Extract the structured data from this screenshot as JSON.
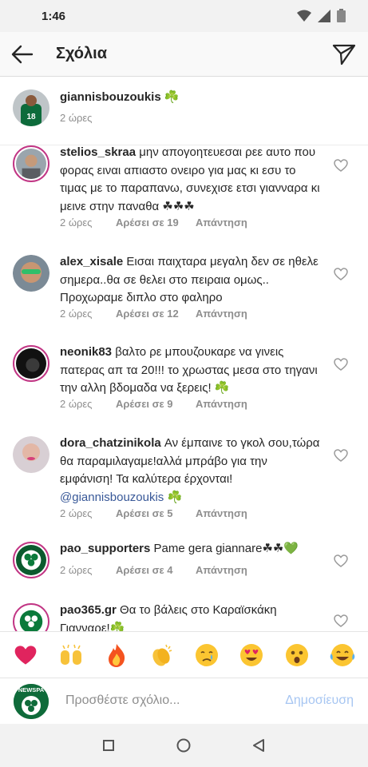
{
  "status_bar": {
    "time": "1:46"
  },
  "header": {
    "title": "Σχόλια"
  },
  "caption": {
    "username": "giannisbouzoukis",
    "text": "☘️",
    "time": "2 ώρες"
  },
  "comments": [
    {
      "username": "stelios_skraa",
      "text": "μην απογοητευεσαι ρεε αυτο που φορας ειναι απιαστο ονειρο για μας κι εσυ το τιμας με το παραπανω, συνεχισε ετσι γιανναρα κι μεινε στην παναθα ☘☘☘",
      "time": "2 ώρες",
      "likes": "Αρέσει σε 19",
      "reply": "Απάντηση"
    },
    {
      "username": "alex_xisale",
      "text": "Εισαι παιχταρα μεγαλη δεν σε ηθελε σημερα..θα σε θελει στο πειραια ομως.. Προχωραμε διπλο στο φαληρο",
      "time": "2 ώρες",
      "likes": "Αρέσει σε 12",
      "reply": "Απάντηση"
    },
    {
      "username": "neonik83",
      "text": "βαλτο ρε μπουζουκαρε να γινεις πατερας απ τα 20!!! το χρωστας μεσα στο τηγανι την αλλη βδομαδα να ξερεις! ☘️",
      "time": "2 ώρες",
      "likes": "Αρέσει σε 9",
      "reply": "Απάντηση"
    },
    {
      "username": "dora_chatzinikola",
      "text": "Αν έμπαινε το γκολ σου,τώρα θα παραμιλαγαμε!αλλά μπράβο για την εμφάνιση! Τα καλύτερα έρχονται!",
      "mention": "@giannisbouzoukis",
      "mention_suffix": "☘️",
      "time": "2 ώρες",
      "likes": "Αρέσει σε 5",
      "reply": "Απάντηση"
    },
    {
      "username": "pao_supporters",
      "text": "Pame gera giannare☘☘💚",
      "time": "2 ώρες",
      "likes": "Αρέσει σε 4",
      "reply": "Απάντηση"
    },
    {
      "username": "pao365.gr",
      "text": "Θα το βάλεις στο Καραϊσκάκη Γιανναρε!☘️",
      "time": "",
      "likes": "",
      "reply": ""
    }
  ],
  "quick_emojis": [
    "red-heart",
    "raising-hands",
    "fire",
    "clapping-hands",
    "crying-face",
    "heart-eyes-face",
    "astonished-face",
    "tears-of-joy-face"
  ],
  "input": {
    "placeholder": "Προσθέστε σχόλιο...",
    "post_label": "Δημοσίευση",
    "avatar_text": "NEWSPA"
  },
  "colors": {
    "accent_link": "#385898",
    "post_disabled": "#a7c6f2",
    "story_ring": "#c13584",
    "muted": "#8e8e8e"
  }
}
